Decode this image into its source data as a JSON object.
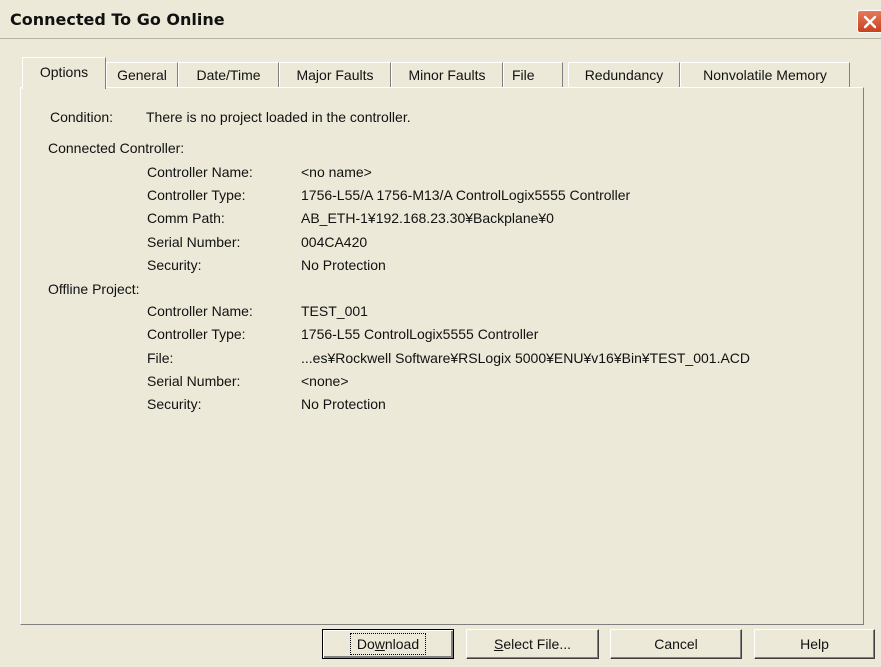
{
  "window": {
    "title": "Connected To Go Online"
  },
  "tabs": [
    {
      "label": "Options",
      "active": true
    },
    {
      "label": "General"
    },
    {
      "label": "Date/Time"
    },
    {
      "label": "Major Faults"
    },
    {
      "label": "Minor Faults"
    },
    {
      "label": "File"
    },
    {
      "label": "Redundancy"
    },
    {
      "label": "Nonvolatile Memory"
    }
  ],
  "condition": {
    "label": "Condition:",
    "value": "There is no project loaded in the controller."
  },
  "connected": {
    "heading": "Connected Controller:",
    "name_label": "Controller Name:",
    "name": "<no name>",
    "type_label": "Controller Type:",
    "type": "1756-L55/A 1756-M13/A ControlLogix5555 Controller",
    "path_label": "Comm Path:",
    "path": "AB_ETH-1¥192.168.23.30¥Backplane¥0",
    "serial_label": "Serial Number:",
    "serial": "004CA420",
    "security_label": "Security:",
    "security": "No Protection"
  },
  "offline": {
    "heading": "Offline Project:",
    "name_label": "Controller Name:",
    "name": "TEST_001",
    "type_label": "Controller Type:",
    "type": "1756-L55 ControlLogix5555 Controller",
    "file_label": "File:",
    "file": "...es¥Rockwell Software¥RSLogix 5000¥ENU¥v16¥Bin¥TEST_001.ACD",
    "serial_label": "Serial Number:",
    "serial": "<none>",
    "security_label": "Security:",
    "security": "No Protection"
  },
  "buttons": {
    "download_a": "Do",
    "download_b": "w",
    "download_c": "nload",
    "select_a": "S",
    "select_b": "elect File...",
    "cancel": "Cancel",
    "help": "Help"
  }
}
